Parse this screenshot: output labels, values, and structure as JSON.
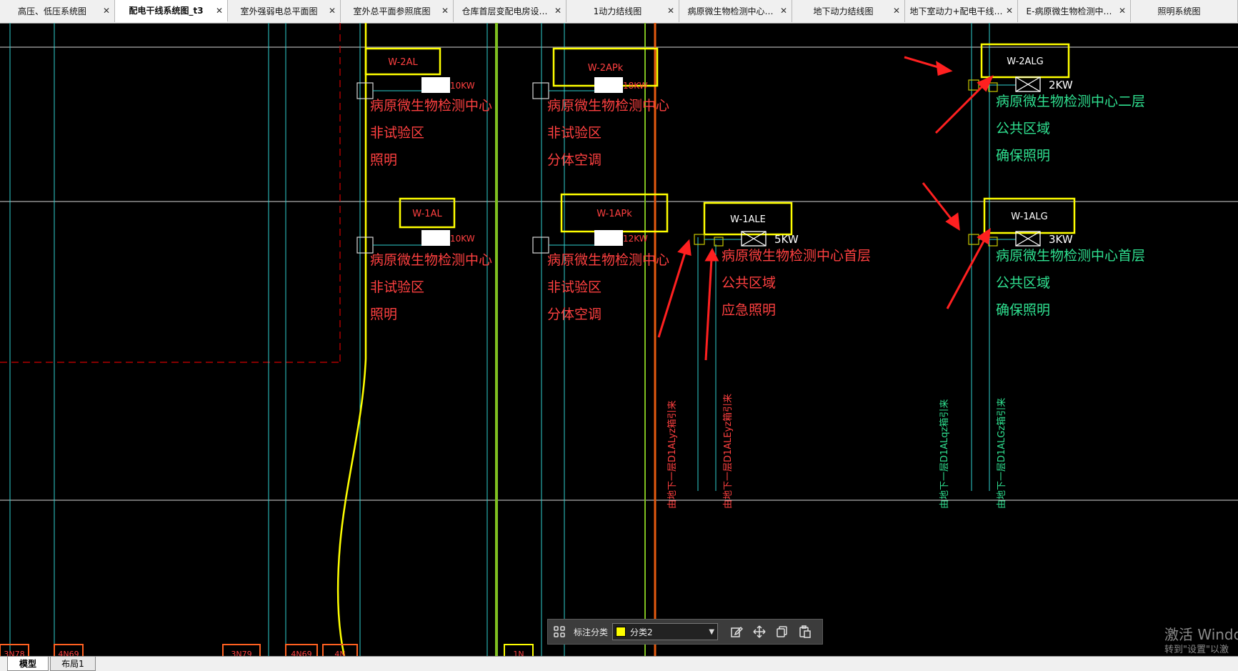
{
  "tabs": [
    {
      "label": "高压、低压系统图",
      "width": 161,
      "active": false
    },
    {
      "label": "配电干线系统图_t3",
      "width": 158,
      "active": true
    },
    {
      "label": "室外强弱电总平面图",
      "width": 158,
      "active": false
    },
    {
      "label": "室外总平面参照底图",
      "width": 158,
      "active": false
    },
    {
      "label": "仓库首层变配电房设…",
      "width": 158,
      "active": false
    },
    {
      "label": "1动力结线图",
      "width": 158,
      "active": false
    },
    {
      "label": "病原微生物检测中心…",
      "width": 158,
      "active": false
    },
    {
      "label": "地下动力结线图",
      "width": 158,
      "active": false
    },
    {
      "label": "地下室动力+配电干线…",
      "width": 158,
      "active": false
    },
    {
      "label": "E-病原微生物检测中…",
      "width": 158,
      "active": false
    },
    {
      "label": "照明系统图",
      "width": 150,
      "active": false
    }
  ],
  "close_glyph": "✕",
  "drawing": {
    "panels": [
      {
        "id": "W-2AL",
        "power": "10KW",
        "lines": [
          "病原微生物检测中心",
          "非试验区",
          "照明"
        ]
      },
      {
        "id": "W-2APk",
        "power": "18KW",
        "lines": [
          "病原微生物检测中心",
          "非试验区",
          "分体空调"
        ]
      },
      {
        "id": "W-2ALG",
        "power": "2KW",
        "lines": [
          "病原微生物检测中心二层",
          "公共区域",
          "确保照明"
        ]
      },
      {
        "id": "W-1AL",
        "power": "10KW",
        "lines": [
          "病原微生物检测中心",
          "非试验区",
          "照明"
        ]
      },
      {
        "id": "W-1APk",
        "power": "12KW",
        "lines": [
          "病原微生物检测中心",
          "非试验区",
          "分体空调"
        ]
      },
      {
        "id": "W-1ALE",
        "power": "5KW",
        "lines": [
          "病原微生物检测中心首层",
          "公共区域",
          "应急照明"
        ]
      },
      {
        "id": "W-1ALG",
        "power": "3KW",
        "lines": [
          "病原微生物检测中心首层",
          "公共区域",
          "确保照明"
        ]
      }
    ],
    "vertical_notes": [
      "由地下一层D1ALyz箱引来",
      "由地下一层D1ALEyz箱引来",
      "由地下一层D1ALqz箱引来",
      "由地下一层D1ALGz箱引来"
    ],
    "bottom_labels": [
      "3N78",
      "4N69",
      "3N79",
      "4N69",
      "4N",
      "1N"
    ]
  },
  "toolbar": {
    "label": "标注分类",
    "selected": "分类2",
    "swatch_color": "#ffff00",
    "icons": [
      "grid-icon",
      "edit-icon",
      "move-icon",
      "copy-icon",
      "paste-icon"
    ]
  },
  "bottom_tabs": [
    "模型",
    "布局1"
  ],
  "watermark": {
    "title": "激活 Windo",
    "subtitle": "转到\"设置\"以激"
  }
}
